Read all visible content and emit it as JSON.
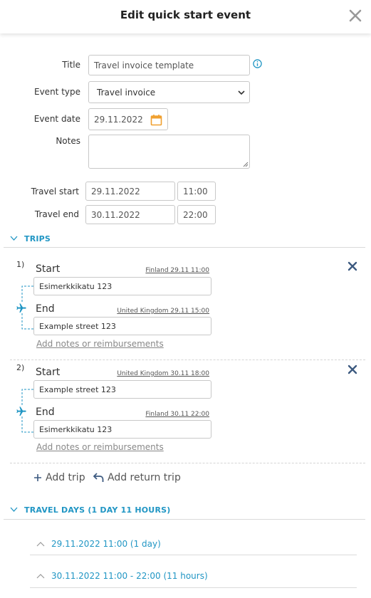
{
  "header": {
    "title": "Edit quick start event"
  },
  "form": {
    "title_label": "Title",
    "title_value": "Travel invoice template",
    "event_type_label": "Event type",
    "event_type_value": "Travel invoice",
    "event_date_label": "Event date",
    "event_date_value": "29.11.2022",
    "notes_label": "Notes",
    "notes_value": "",
    "travel_start_label": "Travel start",
    "travel_start_date": "29.11.2022",
    "travel_start_time": "11:00",
    "travel_end_label": "Travel end",
    "travel_end_date": "30.11.2022",
    "travel_end_time": "22:00"
  },
  "trips_section": {
    "header": "TRIPS",
    "trips": [
      {
        "number": "1)",
        "start_label": "Start",
        "start_meta": "Finland 29.11 11:00",
        "start_address": "Esimerkkikatu 123",
        "end_label": "End",
        "end_meta": "United Kingdom 29.11 15:00",
        "end_address": "Example street 123",
        "notes_link": "Add notes or reimbursements"
      },
      {
        "number": "2)",
        "start_label": "Start",
        "start_meta": "United Kingdom 30.11 18:00",
        "start_address": "Example street 123",
        "end_label": "End",
        "end_meta": "Finland 30.11 22:00",
        "end_address": "Esimerkkikatu 123",
        "notes_link": "Add notes or reimbursements"
      }
    ],
    "add_trip": "Add trip",
    "add_return_trip": "Add return trip"
  },
  "travel_days": {
    "header": "TRAVEL DAYS (1 DAY 11 HOURS)",
    "days": [
      {
        "label": "29.11.2022 11:00 (1 day)"
      },
      {
        "label": "30.11.2022 11:00 - 22:00 (11 hours)"
      }
    ]
  },
  "colors": {
    "accent": "#2196c4",
    "close_x": "#3d5a80",
    "calendar": "#f0a030"
  },
  "icons": [
    "close-icon",
    "info-icon",
    "calendar-icon",
    "chevron-down-icon",
    "plane-icon",
    "plus-icon",
    "undo-icon",
    "chevron-up-icon"
  ]
}
